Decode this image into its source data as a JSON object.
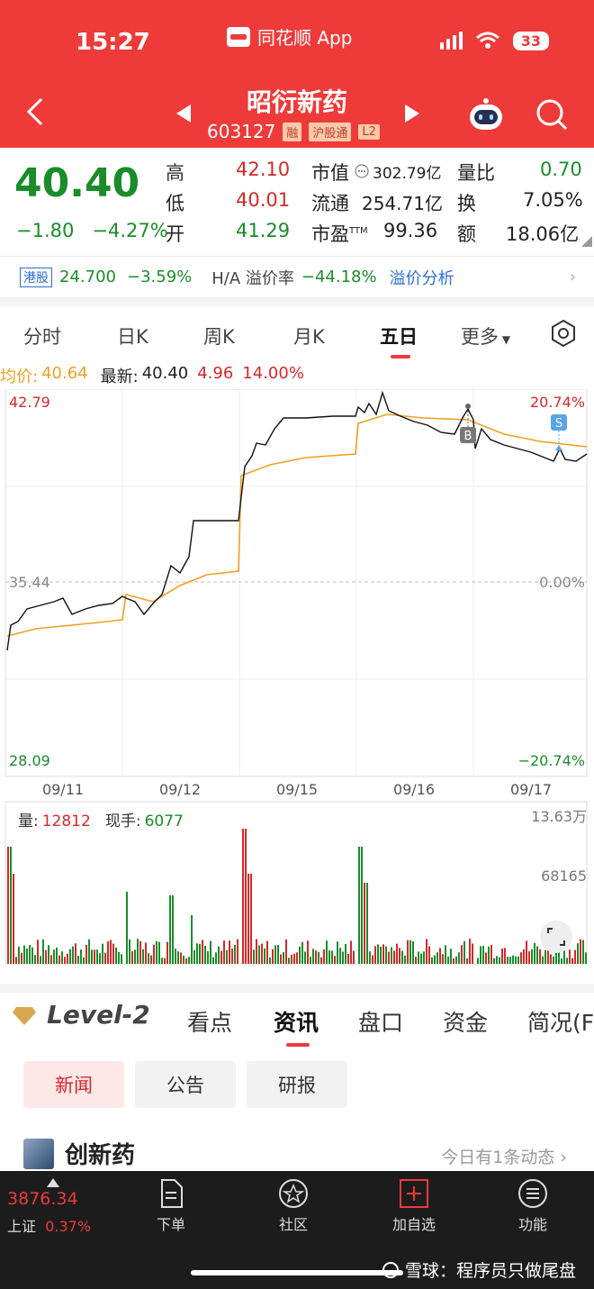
{
  "status_bar": {
    "time": "15:27",
    "app": "同花顺 App",
    "battery": "33"
  },
  "header": {
    "stock_name": "昭衍新药",
    "code": "603127",
    "tags": [
      "融",
      "沪股通",
      "L2"
    ]
  },
  "quote": {
    "price": "40.40",
    "change": "−1.80",
    "change_pct": "−4.27%",
    "high_label": "高",
    "high": "42.10",
    "low_label": "低",
    "low": "40.01",
    "open_label": "开",
    "open": "41.29",
    "mktcap_label": "市值",
    "mktcap": "302.79亿",
    "float_label": "流通",
    "float": "254.71亿",
    "pe_label": "市盈",
    "pe_sup": "TTM",
    "pe": "99.36",
    "vol_ratio_label": "量比",
    "vol_ratio": "0.70",
    "turnover_label": "换",
    "turnover": "7.05%",
    "amount_label": "额",
    "amount": "18.06亿"
  },
  "hk": {
    "tag": "港股",
    "price": "24.700",
    "pct": "−3.59%",
    "premium_label": "H/A 溢价率",
    "premium": "−44.18%",
    "link": "溢价分析"
  },
  "tabs": [
    "分时",
    "日K",
    "周K",
    "月K",
    "五日",
    "更多"
  ],
  "info": {
    "avg_label": "均价:",
    "avg": "40.64",
    "last_label": "最新:",
    "last": "40.40",
    "amp": "4.96",
    "amp_pct": "14.00%"
  },
  "chart_labels": {
    "top": "42.79",
    "mid": "35.44",
    "bottom": "28.09",
    "top_pct": "20.74%",
    "mid_pct": "0.00%",
    "bottom_pct": "−20.74%",
    "dates": [
      "09/11",
      "09/12",
      "09/15",
      "09/16",
      "09/17"
    ],
    "marker_b": "B",
    "marker_s": "S"
  },
  "volume": {
    "vol_label": "量:",
    "vol": "12812",
    "hand_label": "现手:",
    "hand": "6077",
    "max": "13.63万",
    "mid": "68165"
  },
  "news_tabs": {
    "level2": "Level-2",
    "items": [
      "看点",
      "资讯",
      "盘口",
      "资金",
      "简况(F"
    ]
  },
  "pills": [
    "新闻",
    "公告",
    "研报"
  ],
  "topic": {
    "title": "创新药",
    "more": "今日有1条动态"
  },
  "bottom": {
    "index_value": "3876.34",
    "index_name": "上证",
    "index_pct": "0.37%",
    "items": [
      "下单",
      "社区",
      "加自选",
      "功能"
    ]
  },
  "watermark": "雪球：程序员只做尾盘",
  "colors": {
    "header_red": "#ef3a3a",
    "up_red": "#d62828",
    "down_green": "#1a8c2a",
    "avg_orange": "#f0a020"
  }
}
